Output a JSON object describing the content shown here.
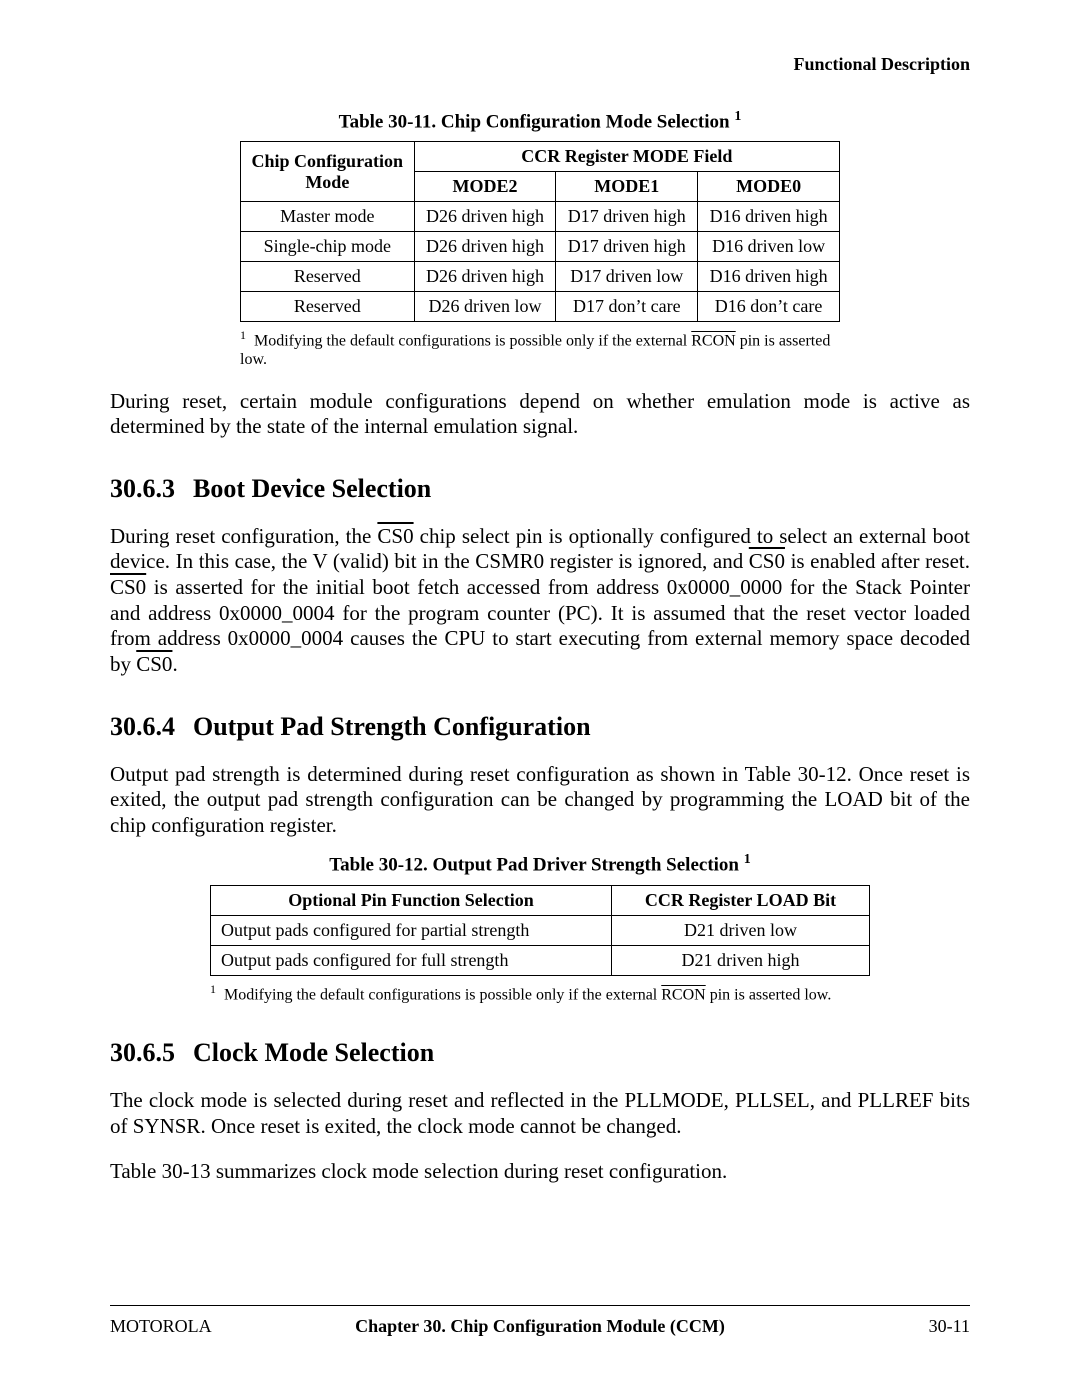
{
  "header": {
    "right": "Functional Description"
  },
  "table1": {
    "caption_prefix": "Table 30-11. Chip Configuration Mode Selection ",
    "col_mode": "Chip Configuration Mode",
    "col_ccr": "CCR Register MODE Field",
    "subcols": [
      "MODE2",
      "MODE1",
      "MODE0"
    ],
    "rows": [
      [
        "Master mode",
        "D26 driven high",
        "D17 driven high",
        "D16 driven high"
      ],
      [
        "Single-chip mode",
        "D26 driven high",
        "D17 driven high",
        "D16 driven low"
      ],
      [
        "Reserved",
        "D26 driven high",
        "D17 driven low",
        "D16 driven high"
      ],
      [
        "Reserved",
        "D26 driven low",
        "D17 don’t care",
        "D16 don’t care"
      ]
    ],
    "footnote_pre": "Modifying the default configurations is possible only if the external ",
    "footnote_sig": "RCON",
    "footnote_post": " pin is asserted low."
  },
  "para1": "During reset, certain module configurations depend on whether emulation mode is active as determined by the state of the internal emulation signal.",
  "sec1": {
    "num": "30.6.3",
    "title": "Boot Device Selection"
  },
  "para2": {
    "a": "During reset configuration, the ",
    "cs0": "CS0",
    "b": " chip select pin is optionally configured to select an external boot device. In this case, the V (valid) bit in the CSMR0 register is ignored, and ",
    "c": " is enabled after reset. ",
    "d": " is asserted for the initial boot fetch accessed from address 0x0000_0000 for the Stack Pointer and address 0x0000_0004 for the program counter (PC). It is assumed that the reset vector loaded from address 0x0000_0004 causes the CPU to start executing from external memory space decoded by ",
    "e": "."
  },
  "sec2": {
    "num": "30.6.4",
    "title": "Output Pad Strength Configuration"
  },
  "para3": "Output pad strength is determined during reset configuration as shown in Table 30-12. Once reset is exited, the output pad strength configuration can be changed by programming the LOAD bit of the chip configuration register.",
  "table2": {
    "caption_prefix": "Table 30-12. Output Pad Driver Strength Selection ",
    "col1": "Optional Pin Function Selection",
    "col2": "CCR Register LOAD Bit",
    "rows": [
      [
        "Output pads configured for partial strength",
        "D21 driven low"
      ],
      [
        "Output pads configured for full strength",
        "D21 driven high"
      ]
    ],
    "footnote_pre": "Modifying the default configurations is possible only if the external ",
    "footnote_sig": "RCON",
    "footnote_post": " pin is asserted low."
  },
  "sec3": {
    "num": "30.6.5",
    "title": "Clock Mode Selection"
  },
  "para4": "The clock mode is selected during reset and reflected in the PLLMODE, PLLSEL, and PLLREF bits of SYNSR. Once reset is exited, the clock mode cannot be changed.",
  "para5": "Table 30-13 summarizes clock mode selection during reset configuration.",
  "footer": {
    "left": "MOTOROLA",
    "center": "Chapter 30.  Chip Configuration Module (CCM)",
    "right": "30-11"
  }
}
